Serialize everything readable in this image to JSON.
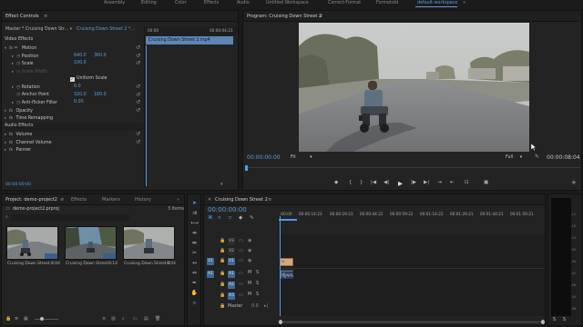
{
  "workspaces": [
    "Assembly",
    "Editing",
    "Color",
    "Effects",
    "Audio",
    "Untitled Workspace",
    "Correct-Format",
    "Formetold",
    "default-workspace"
  ],
  "workspace_menu_glyph": "»",
  "effect_controls": {
    "tab": "Effect Controls",
    "menu_glyph": "≡",
    "source": "Master * Cruising Down Str...",
    "sequence": "Cruising Down Street 2 *...",
    "timecode_head": "00:00",
    "timecode_tail": "00:00:04:23",
    "clip_label": "Cruising Down Street 2.mp4",
    "video_effects_label": "Video Effects",
    "audio_effects_label": "Audio Effects",
    "props": [
      {
        "label": "Motion",
        "kind": "fx-section",
        "x": "",
        "y": ""
      },
      {
        "label": "Position",
        "kind": "prop",
        "x": "640.0",
        "y": "360.0"
      },
      {
        "label": "Scale",
        "kind": "prop",
        "x": "100.0",
        "y": ""
      },
      {
        "label": "Scale Width",
        "kind": "disabled",
        "x": "",
        "y": ""
      },
      {
        "label": "Uniform Scale",
        "kind": "checkbox",
        "x": "",
        "y": ""
      },
      {
        "label": "Rotation",
        "kind": "prop",
        "x": "0.0",
        "y": ""
      },
      {
        "label": "Anchor Point",
        "kind": "prop",
        "x": "320.0",
        "y": "180.0"
      },
      {
        "label": "Anti-flicker Filter",
        "kind": "prop",
        "x": "0.00",
        "y": ""
      },
      {
        "label": "Opacity",
        "kind": "fx-section",
        "x": "",
        "y": ""
      },
      {
        "label": "Time Remapping",
        "kind": "fx-section",
        "x": "",
        "y": ""
      }
    ],
    "audio_props": [
      "Volume",
      "Channel Volume",
      "Panner"
    ],
    "footer_timecode": "00:00:00:00"
  },
  "program_monitor": {
    "title": "Program: Cruising Down Street 2",
    "menu_glyph": "≡",
    "timecode": "00:00:00:00",
    "fit": "Fit",
    "quality": "Full",
    "duration": "00:00:08:04",
    "transport": [
      "◆",
      "{",
      "}",
      "|◀",
      "◀|",
      "▶",
      "|▶",
      "▶|",
      "⇥",
      "⇤",
      "⊡",
      "▣"
    ],
    "add_glyph": "+"
  },
  "project": {
    "tabs": [
      "Project: demo-project2",
      "Effects",
      "Markers",
      "History"
    ],
    "menu_glyph": "≡",
    "tab_more": "»",
    "file": "demo-project2.prproj",
    "item_count": "3 Items",
    "clips": [
      {
        "name": "Cruising Down Street...",
        "duration": "8:04"
      },
      {
        "name": "Cruising Down Street...",
        "duration": "9:14"
      },
      {
        "name": "Cruising Down Street 2",
        "duration": "8:04"
      }
    ]
  },
  "timeline": {
    "tab": "Cruising Down Street 2",
    "menu_glyph": "≡",
    "timecode": "00:00:00:00",
    "ruler": [
      ":00:00",
      "00:00:14:23",
      "00:00:29:23",
      "00:00:44:22",
      "00:00:59:22",
      "00:01:14:22",
      "00:01:29:21",
      "00:01:44:21",
      "00:01:59:21"
    ],
    "video_tracks": [
      "V3",
      "V2",
      "V1"
    ],
    "audio_tracks": [
      "A1",
      "A2",
      "A3"
    ],
    "source_v": "V1",
    "source_a": "A1",
    "master_label": "Master",
    "master_value": "0.0",
    "mute": "M",
    "solo": "S"
  },
  "vu_meter": {
    "ticks": [
      "-12",
      "-18",
      "-24",
      "-30",
      "-36",
      "-42",
      "-48",
      "-54",
      "dB"
    ],
    "solo": [
      "S",
      "S"
    ]
  },
  "colors": {
    "accent": "#5a9ed6",
    "video_clip": "#d6a77a",
    "audio_clip": "#5a6f8e",
    "playhead": "#4d9cf0"
  }
}
